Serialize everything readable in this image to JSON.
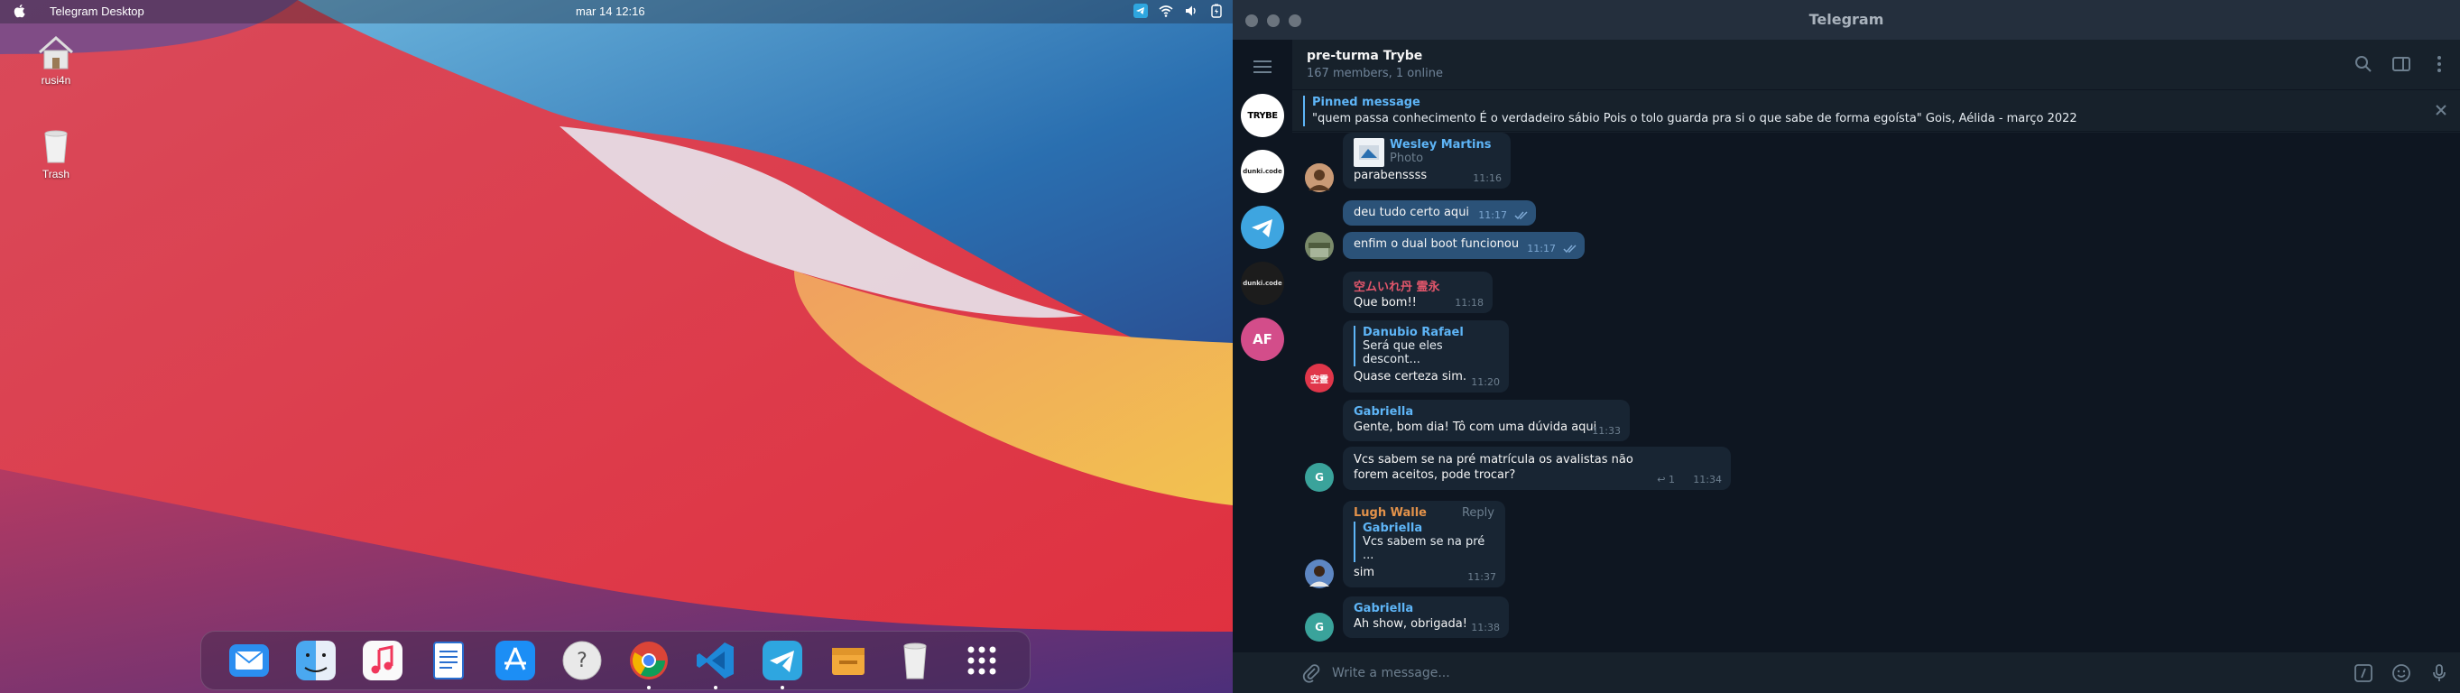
{
  "menubar": {
    "app_name": "Telegram Desktop",
    "clock": "mar 14  12:16"
  },
  "desktop": {
    "icons": [
      {
        "label": "rusi4n",
        "icon": "home-folder-icon"
      },
      {
        "label": "Trash",
        "icon": "trash-icon"
      }
    ]
  },
  "dock": {
    "items": [
      {
        "name": "mail-app-icon",
        "running": false
      },
      {
        "name": "finder-icon",
        "running": false
      },
      {
        "name": "music-app-icon",
        "running": false
      },
      {
        "name": "text-editor-icon",
        "running": false
      },
      {
        "name": "app-store-icon",
        "running": false
      },
      {
        "name": "script-editor-icon",
        "running": false
      },
      {
        "name": "chrome-icon",
        "running": true
      },
      {
        "name": "vscode-icon",
        "running": true
      },
      {
        "name": "telegram-icon",
        "running": true
      },
      {
        "name": "archive-icon",
        "running": false
      },
      {
        "name": "dock-trash-icon",
        "running": false
      },
      {
        "name": "launchpad-grid-icon",
        "running": false
      }
    ]
  },
  "window": {
    "title": "Telegram"
  },
  "sidebar": {
    "chats": [
      {
        "name": "Trybe",
        "label": "TRYBE",
        "color": "#ffffff"
      },
      {
        "name": "dunki-code",
        "label": "dunki.code",
        "color": "#ffffff"
      },
      {
        "name": "Telegram",
        "label": "",
        "color": "#3ea5e0"
      },
      {
        "name": "dunki-code-dark",
        "label": "dunki.code",
        "color": "#1c1c1c"
      },
      {
        "name": "AF",
        "label": "AF",
        "color": "#d34d8a"
      }
    ]
  },
  "chat": {
    "name": "pre-turma Trybe",
    "members": "167 members, 1 online"
  },
  "pinned": {
    "label": "Pinned message",
    "text": "\"quem passa conhecimento  É o verdadeiro sábio  Pois o tolo guarda pra si o que sabe de forma egoísta\"  Gois, Aélida - março 2022"
  },
  "messages": [
    {
      "id": "m1",
      "dir": "in",
      "reply_name": "Wesley Martins",
      "reply_text": "Photo",
      "text": "parabenssss",
      "time": "11:16"
    },
    {
      "id": "m2",
      "dir": "out",
      "text": "deu tudo certo aqui",
      "time": "11:17"
    },
    {
      "id": "m3",
      "dir": "out",
      "text": "enfim o dual boot funcionou",
      "time": "11:17"
    },
    {
      "id": "m4",
      "dir": "in",
      "author": "空ムいれ丹 霊永",
      "text": "Que bom!!",
      "time": "11:18"
    },
    {
      "id": "m5",
      "dir": "in",
      "reply_name": "Danubio Rafael",
      "reply_text": "Será que eles descont...",
      "text": "Quase certeza sim.",
      "time": "11:20",
      "avatar_label": "空霊"
    },
    {
      "id": "m6",
      "dir": "in",
      "author": "Gabriella",
      "text": "Gente, bom dia! Tô com uma dúvida aqui",
      "time": "11:33"
    },
    {
      "id": "m7",
      "dir": "in",
      "text": "Vcs sabem se na pré matrícula os avalistas não forem aceitos, pode trocar?",
      "time": "11:34",
      "replies": "1",
      "avatar_label": "G"
    },
    {
      "id": "m8",
      "dir": "in",
      "author": "Lugh Walle",
      "action": "Reply",
      "reply_name": "Gabriella",
      "reply_text": "Vcs sabem se na pré ...",
      "text": "sim",
      "time": "11:37"
    },
    {
      "id": "m9",
      "dir": "in",
      "author": "Gabriella",
      "text": "Ah show, obrigada!",
      "time": "11:38",
      "avatar_label": "G"
    }
  ],
  "composer": {
    "placeholder": "Write a message..."
  }
}
